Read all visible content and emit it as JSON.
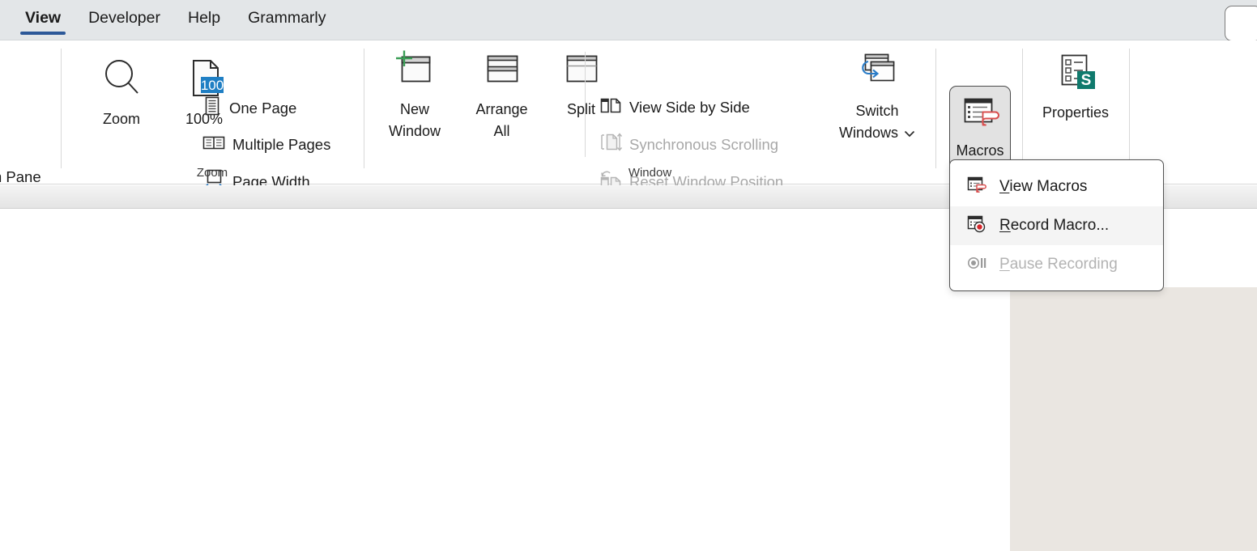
{
  "app": {
    "active_tab": "View"
  },
  "tabbar": {
    "tabs": [
      {
        "label": "View",
        "active": true
      },
      {
        "label": "Developer",
        "active": false
      },
      {
        "label": "Help",
        "active": false
      },
      {
        "label": "Grammarly",
        "active": false
      }
    ]
  },
  "ribbon": {
    "clipped_left": {
      "label": "n Pane",
      "icon": "navigation-pane-icon"
    },
    "groups": [
      {
        "name": "zoom",
        "label": "Zoom",
        "buttons": [
          {
            "label": "Zoom",
            "icon": "magnifier-icon"
          },
          {
            "label": "100%",
            "icon": "page-100-icon",
            "badge": "100"
          }
        ],
        "items": [
          {
            "label": "One Page",
            "icon": "one-page-icon",
            "disabled": false
          },
          {
            "label": "Multiple Pages",
            "icon": "multiple-pages-icon",
            "disabled": false
          },
          {
            "label": "Page Width",
            "icon": "page-width-icon",
            "disabled": false
          }
        ]
      },
      {
        "name": "window",
        "label": "Window",
        "buttons": [
          {
            "label": "New Window",
            "line1": "New",
            "line2": "Window",
            "icon": "new-window-icon"
          },
          {
            "label": "Arrange All",
            "line1": "Arrange",
            "line2": "All",
            "icon": "arrange-all-icon"
          },
          {
            "label": "Split",
            "line1": "Split",
            "line2": "",
            "icon": "split-icon"
          }
        ],
        "items": [
          {
            "label": "View Side by Side",
            "icon": "view-side-by-side-icon",
            "disabled": false
          },
          {
            "label": "Synchronous Scrolling",
            "icon": "synchronous-scrolling-icon",
            "disabled": true
          },
          {
            "label": "Reset Window Position",
            "icon": "reset-window-position-icon",
            "disabled": true
          }
        ],
        "switch_windows": {
          "line1": "Switch",
          "line2": "Windows",
          "icon": "switch-windows-icon",
          "chevron": "chevron-down-icon"
        }
      },
      {
        "name": "macros",
        "label": "",
        "macros_button": {
          "label": "Macros",
          "icon": "macros-icon",
          "chevron": "chevron-down-icon",
          "pressed": true
        }
      },
      {
        "name": "sharepoint",
        "label": "",
        "properties_button": {
          "label": "Properties",
          "icon": "properties-icon",
          "badge_letter": "S"
        }
      }
    ]
  },
  "macros_menu": {
    "open": true,
    "items": [
      {
        "label": "View Macros",
        "accel": "V",
        "rest": "iew Macros",
        "icon": "view-macros-icon",
        "disabled": false,
        "hover": false
      },
      {
        "label": "Record Macro...",
        "accel": "R",
        "rest": "ecord Macro...",
        "icon": "record-macro-icon",
        "disabled": false,
        "hover": true
      },
      {
        "label": "Pause Recording",
        "accel": "P",
        "rest": "ause Recording",
        "icon": "pause-recording-icon",
        "disabled": true,
        "hover": false
      }
    ]
  },
  "colors": {
    "tabbar_bg": "#e3e6e8",
    "active_tab_underline": "#2c5898",
    "zoom_badge_blue": "#1f7fc4",
    "page_width_arrow_blue": "#2a7cc7",
    "macro_red": "#d94f4f",
    "sharepoint_teal": "#107a6d",
    "disabled_text": "#a8a8a8",
    "document_bg": "#ffffff",
    "page_margin_bg": "#eae6e1"
  }
}
